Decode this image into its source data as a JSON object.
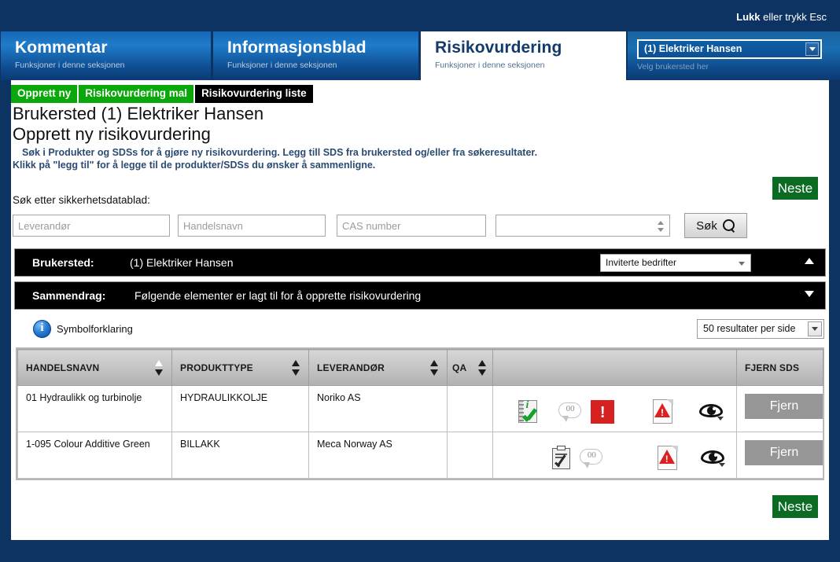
{
  "window": {
    "close_hint_bold": "Lukk",
    "close_hint_rest": " eller trykk Esc"
  },
  "tabs": [
    {
      "title": "Kommentar",
      "subtitle": "Funksjoner i denne seksjonen",
      "active": false
    },
    {
      "title": "Informasjonsblad",
      "subtitle": "Funksjoner i denne seksjonen",
      "active": false
    },
    {
      "title": "Risikovurdering",
      "subtitle": "Funksjoner i denne seksjonen",
      "active": true
    }
  ],
  "location_picker": {
    "value": "(1) Elektriker Hansen",
    "caption": "Velg brukersted her",
    "icon": "chevron-down-icon"
  },
  "subnav": [
    {
      "label": "Opprett ny",
      "style": "green"
    },
    {
      "label": "Risikovurdering mal",
      "style": "green"
    },
    {
      "label": "Risikovurdering liste",
      "style": "black"
    }
  ],
  "headings": {
    "line1": "Brukersted (1) Elektriker Hansen",
    "line2": "Opprett ny risikovurdering",
    "desc_line1": "Søk i Produkter og SDSs for å gjøre ny risikovurdering. Legg till SDS fra brukersted og/eller fra søkeresultater.",
    "desc_line2": "Klikk på \"legg til\" for å legge til de produkter/SDSs du ønsker å sammenligne."
  },
  "next_button": {
    "label": "Neste"
  },
  "search": {
    "label": "Søk etter sikkerhetsdatablad:",
    "supplier_placeholder": "Leverandør",
    "tradename_placeholder": "Handelsnavn",
    "cas_placeholder": "CAS number",
    "extra_select_value": "",
    "button_label": "Søk",
    "button_icon": "search-icon"
  },
  "brukersted_bar": {
    "label": "Brukersted:",
    "value": "(1) Elektriker Hansen",
    "select_value": "Inviterte bedrifter",
    "caret": "caret-up-icon"
  },
  "sammendrag_bar": {
    "label": "Sammendrag:",
    "value": "Følgende elementer er lagt til for å opprette risikovurdering",
    "caret": "caret-down-icon"
  },
  "legend": {
    "icon": "info-icon",
    "label": "Symbolforklaring"
  },
  "per_page": {
    "value": "50 resultater per side",
    "icon": "chevron-down-icon"
  },
  "table": {
    "columns": [
      {
        "label": "HANDELSNAVN",
        "sortable": true
      },
      {
        "label": "PRODUKTTYPE",
        "sortable": true
      },
      {
        "label": "LEVERANDØR",
        "sortable": true
      },
      {
        "label": "QA",
        "sortable": true
      },
      {
        "label": "",
        "sortable": false
      },
      {
        "label": "FJERN SDS",
        "sortable": false
      }
    ],
    "rows": [
      {
        "handelsnavn": "01 Hydraulikk og turbinolje",
        "produkttype": "HYDRAULIKKOLJE",
        "leverandor": "Noriko AS",
        "qa": "filled-dot",
        "icons": [
          "notebook-green-check-icon",
          "comment-bubble-icon",
          "ghs-exclamation-icon",
          "sds-document-warning-icon",
          "view-eye-icon"
        ],
        "comment_count": "00",
        "fjern_label": "Fjern"
      },
      {
        "handelsnavn": "1-095 Colour Additive Green",
        "produkttype": "BILLAKK",
        "leverandor": "Meca Norway AS",
        "qa": "filled-dot",
        "icons": [
          "clipboard-check-icon",
          "comment-bubble-icon",
          "sds-document-warning-icon",
          "view-eye-icon"
        ],
        "comment_count": "00",
        "fjern_label": "Fjern"
      }
    ]
  },
  "colors": {
    "app_background": "#0d3362",
    "tab_active_bg": "#ffffff",
    "green_button": "#0ba80b",
    "next_green": "#0b6b23",
    "fjern_grey": "#969696",
    "bar_black": "#000000",
    "warning_red": "#d62121"
  }
}
